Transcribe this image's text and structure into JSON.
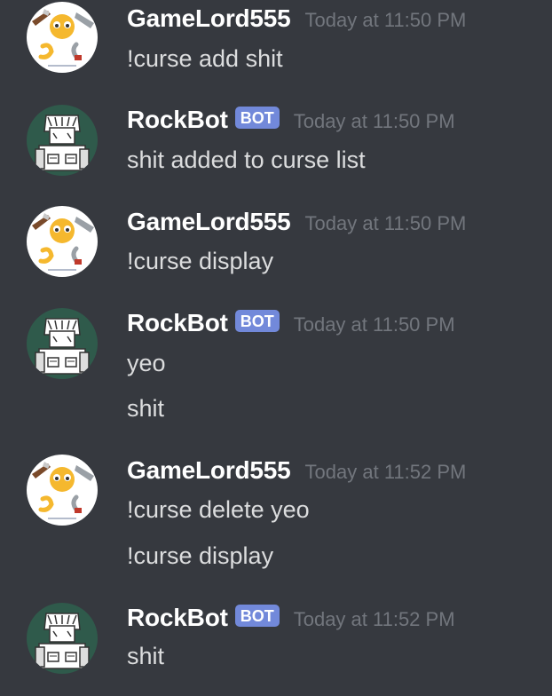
{
  "messages": [
    {
      "author": "GameLord555",
      "bot": false,
      "timestamp": "Today at 11:50 PM",
      "lines": [
        "!curse add shit"
      ]
    },
    {
      "author": "RockBot",
      "bot": true,
      "badge": "BOT",
      "timestamp": "Today at 11:50 PM",
      "lines": [
        "shit added to curse list"
      ]
    },
    {
      "author": "GameLord555",
      "bot": false,
      "timestamp": "Today at 11:50 PM",
      "lines": [
        "!curse display"
      ]
    },
    {
      "author": "RockBot",
      "bot": true,
      "badge": "BOT",
      "timestamp": "Today at 11:50 PM",
      "lines": [
        "yeo",
        "shit"
      ]
    },
    {
      "author": "GameLord555",
      "bot": false,
      "timestamp": "Today at 11:52 PM",
      "lines": [
        "!curse delete yeo",
        "!curse display"
      ]
    },
    {
      "author": "RockBot",
      "bot": true,
      "badge": "BOT",
      "timestamp": "Today at 11:52 PM",
      "lines": [
        "shit"
      ]
    }
  ],
  "colors": {
    "background": "#36393f",
    "username": "#ffffff",
    "timestamp": "#72767d",
    "message_text": "#dcddde",
    "bot_badge": "#7289da",
    "bot_avatar_bg": "#2f5a4b"
  },
  "icons": {
    "user_avatar": "cartoon-ghost-avatar-icon",
    "bot_avatar": "robot-character-avatar-icon"
  }
}
